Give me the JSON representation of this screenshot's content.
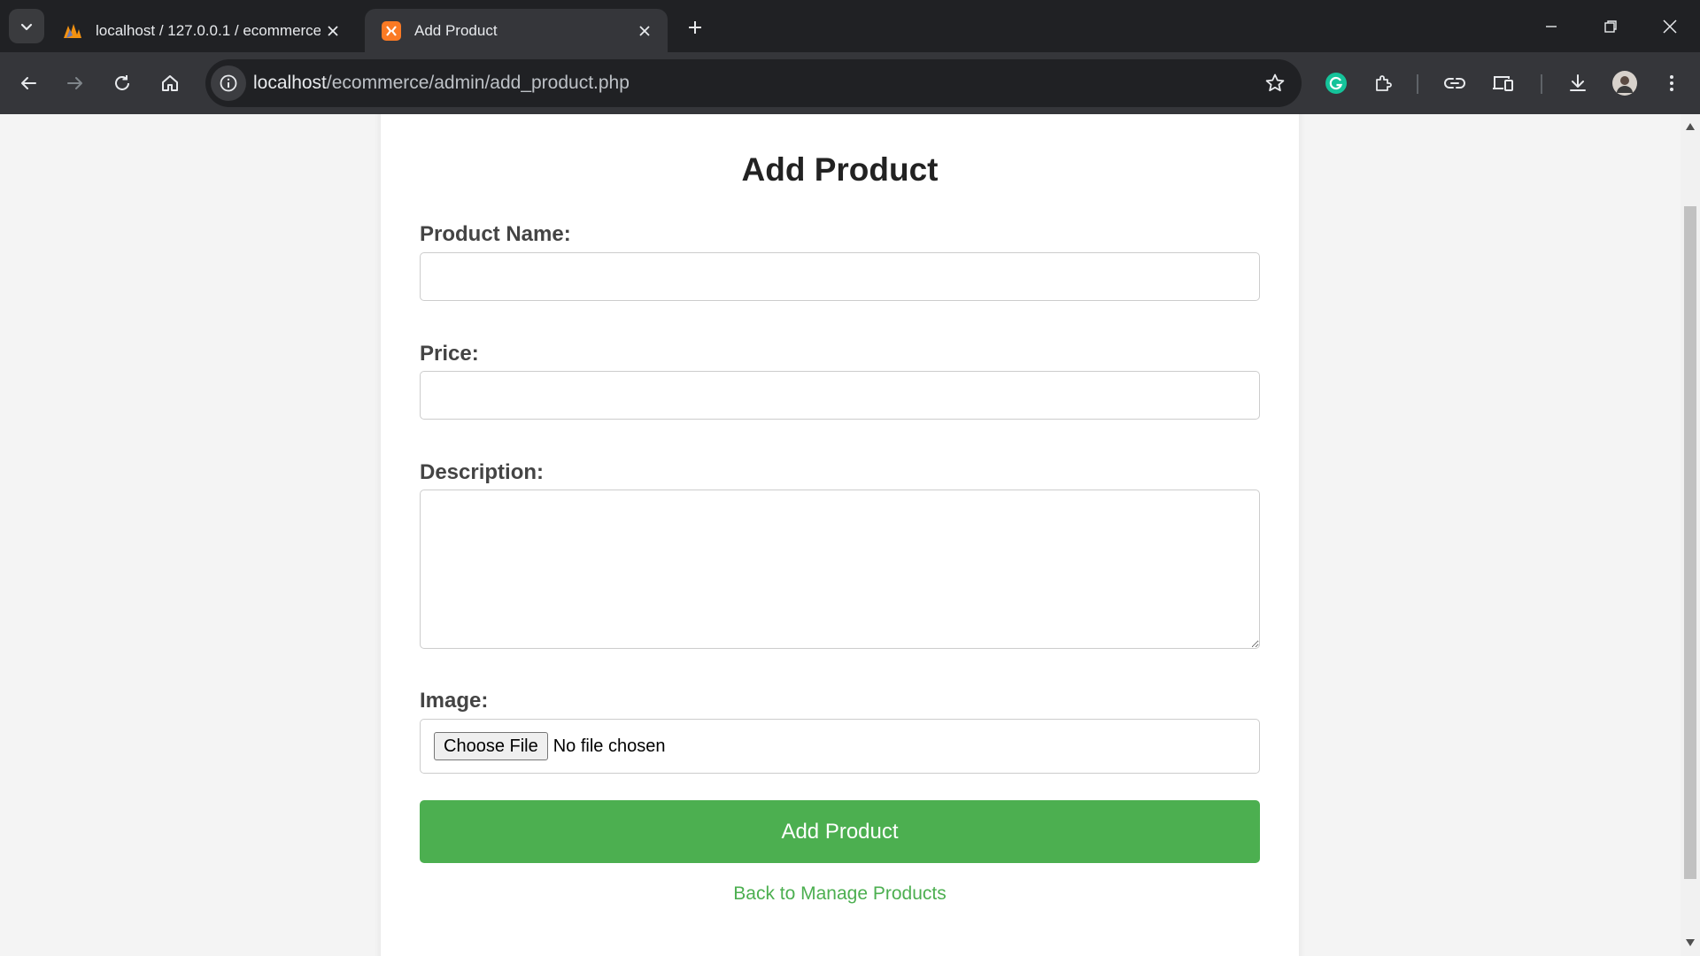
{
  "browser": {
    "tabs": [
      {
        "title": "localhost / 127.0.0.1 / ecommerce",
        "icon": "phpmyadmin-icon",
        "active": false
      },
      {
        "title": "Add Product",
        "icon": "xampp-icon",
        "active": true
      }
    ],
    "url_host": "localhost",
    "url_path": "/ecommerce/admin/add_product.php"
  },
  "page": {
    "title": "Add Product",
    "fields": {
      "name_label": "Product Name:",
      "name_value": "",
      "price_label": "Price:",
      "price_value": "",
      "description_label": "Description:",
      "description_value": "",
      "image_label": "Image:",
      "file_button": "Choose File",
      "file_status": "No file chosen"
    },
    "submit_label": "Add Product",
    "back_link": "Back to Manage Products"
  },
  "colors": {
    "accent": "#4caf50",
    "chrome_dark": "#202124",
    "chrome_toolbar": "#35363a"
  }
}
